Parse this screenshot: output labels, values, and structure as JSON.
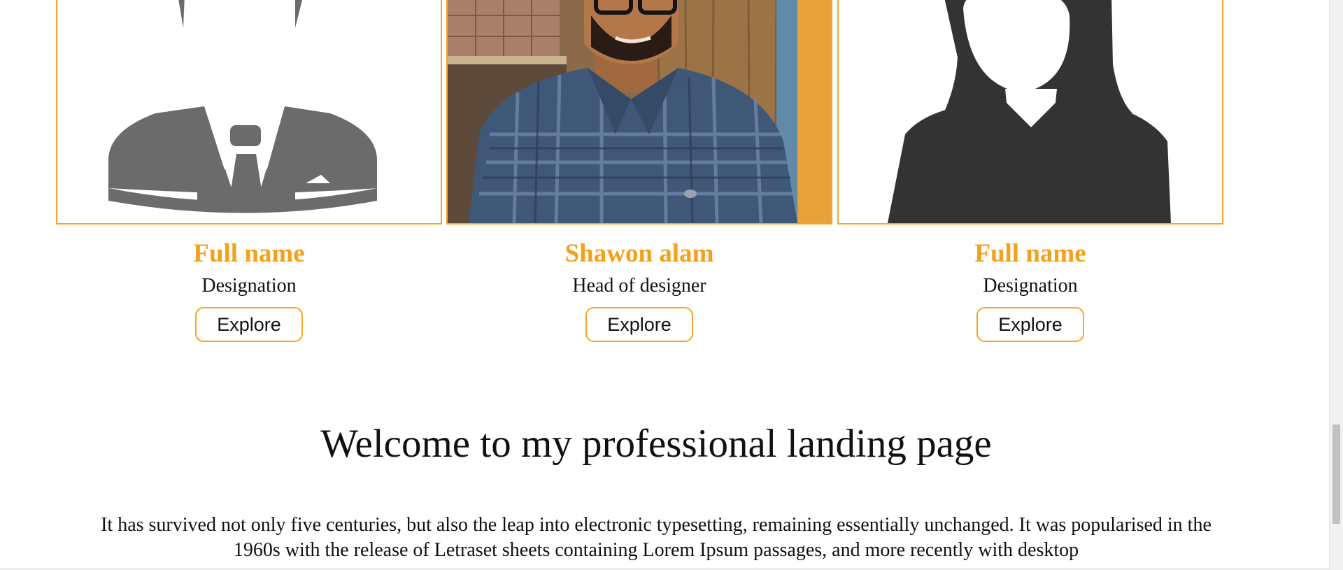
{
  "team": [
    {
      "image": "male-avatar-placeholder",
      "name": "Full name",
      "designation": "Designation",
      "button_label": "Explore"
    },
    {
      "image": "photo-shawon-alam",
      "name": "Shawon alam",
      "designation": "Head of designer",
      "button_label": "Explore"
    },
    {
      "image": "female-avatar-placeholder",
      "name": "Full name",
      "designation": "Designation",
      "button_label": "Explore"
    }
  ],
  "welcome": {
    "heading": "Welcome to my professional landing page",
    "paragraph": "It has survived not only five centuries, but also the leap into electronic typesetting, remaining essentially unchanged. It was popularised in the 1960s with the release of Letraset sheets containing Lorem Ipsum passages, and more recently with desktop"
  },
  "colors": {
    "accent": "#f5a623",
    "name_color": "#f5a01a",
    "text": "#111111"
  }
}
